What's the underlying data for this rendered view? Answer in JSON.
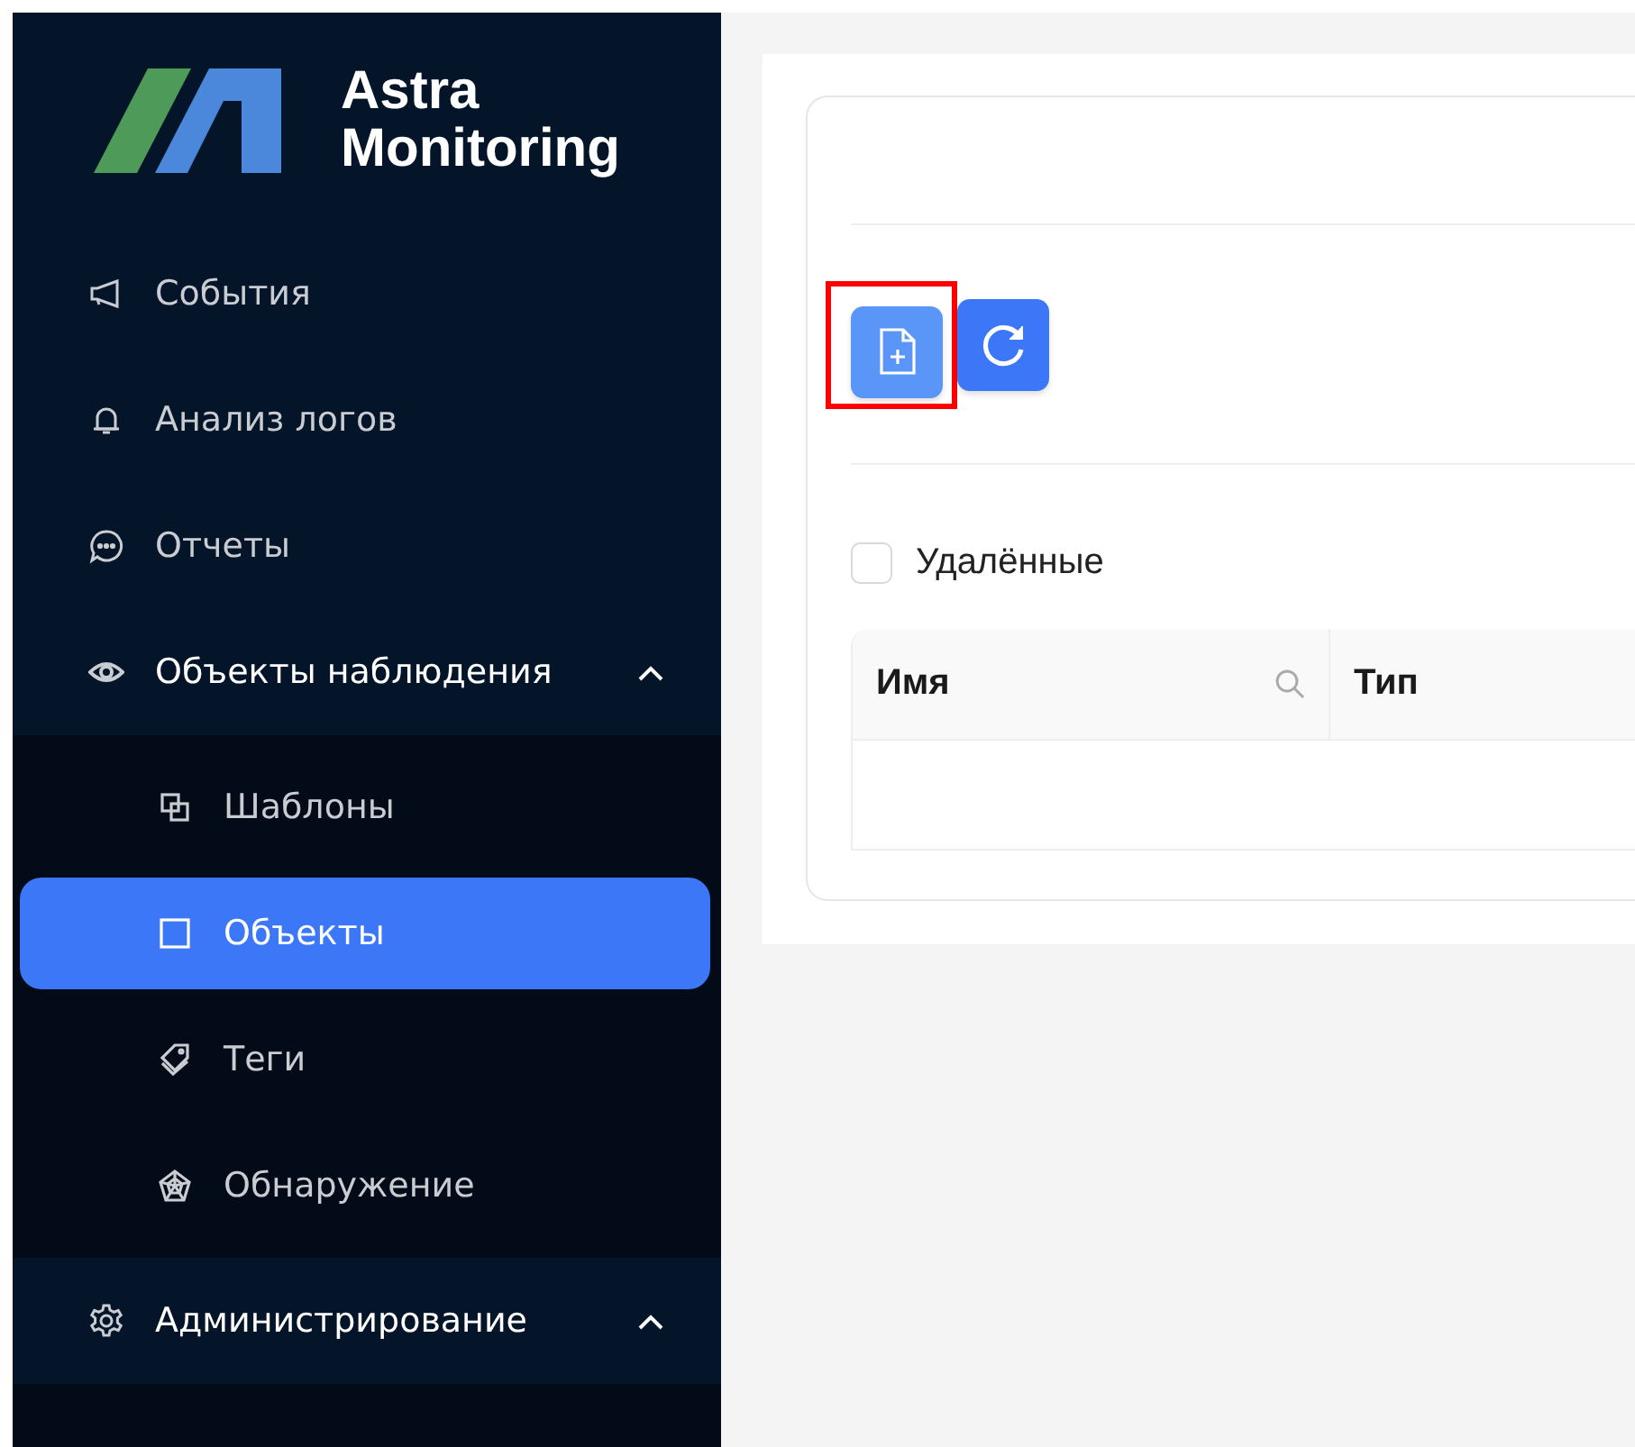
{
  "sidebar": {
    "logo": {
      "line1": "Astra",
      "line2": "Monitoring"
    },
    "items": [
      {
        "label": "События",
        "selected": false
      },
      {
        "label": "Анализ логов",
        "selected": false
      },
      {
        "label": "Отчеты",
        "selected": false
      },
      {
        "label": "Объекты наблюдения",
        "selected": false,
        "expanded": true,
        "children": [
          {
            "label": "Шаблоны",
            "selected": false
          },
          {
            "label": "Объекты",
            "selected": true
          },
          {
            "label": "Теги",
            "selected": false
          },
          {
            "label": "Обнаружение",
            "selected": false
          }
        ]
      },
      {
        "label": "Администрирование",
        "selected": false,
        "expanded": true
      }
    ]
  },
  "toolbar": [
    {
      "kind": "add",
      "highlighted": true
    },
    {
      "kind": "refresh",
      "highlighted": false
    }
  ],
  "filter": {
    "label": "Удалённые",
    "checked": false
  },
  "table": {
    "columns": [
      {
        "label": "Имя",
        "searchable": true
      },
      {
        "label": "Тип",
        "searchable": false
      }
    ]
  }
}
